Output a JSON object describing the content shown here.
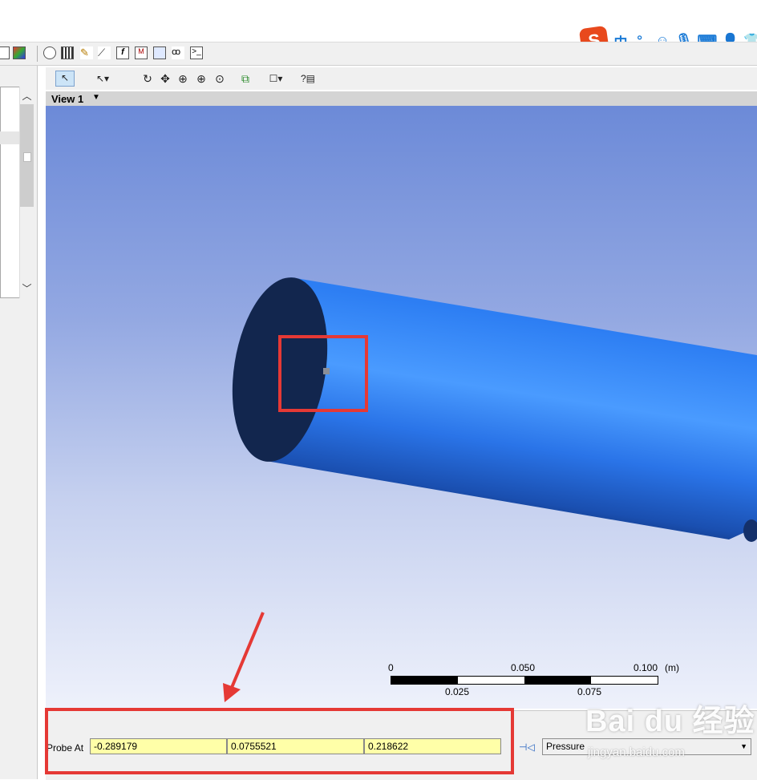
{
  "ime": {
    "mode_label": "中",
    "punct_label": "°,",
    "icons": [
      "sogou-s-icon",
      "smiley-icon",
      "mic-icon",
      "keyboard-icon",
      "user-icon",
      "shirt-icon"
    ],
    "logo_letter": "S"
  },
  "toolbar": {
    "icons": [
      "history-icon",
      "film-icon",
      "edit-icon",
      "pick-icon",
      "function-icon",
      "report-icon",
      "table-icon",
      "binoculars-icon",
      "console-icon"
    ],
    "view_tools": [
      "select-icon",
      "pointer-dropdown-icon",
      "rotate-icon",
      "pan-icon",
      "zoom-box-icon",
      "zoom-in-icon",
      "zoom-fit-icon",
      "copy-icon",
      "viewport-layout-icon",
      "help-icon"
    ]
  },
  "view": {
    "title": "View 1"
  },
  "scale_bar": {
    "labels_top": [
      "0",
      "0.050",
      "0.100"
    ],
    "labels_bottom": [
      "0.025",
      "0.075"
    ],
    "unit": "(m)"
  },
  "probe": {
    "label": "Probe At",
    "x": "-0.289179",
    "y": "0.0755521",
    "z": "0.218622",
    "variable": "Pressure"
  },
  "watermark": {
    "main": "Bai du 经验",
    "sub": "jingyan.baidu.com"
  },
  "colors": {
    "viewport_top": "#6c8ad8",
    "viewport_bottom": "#eef1fb",
    "cylinder": "#2f7ff0",
    "cap": "#12264e",
    "annotation": "#e53935",
    "probe_field": "#ffffa8"
  }
}
